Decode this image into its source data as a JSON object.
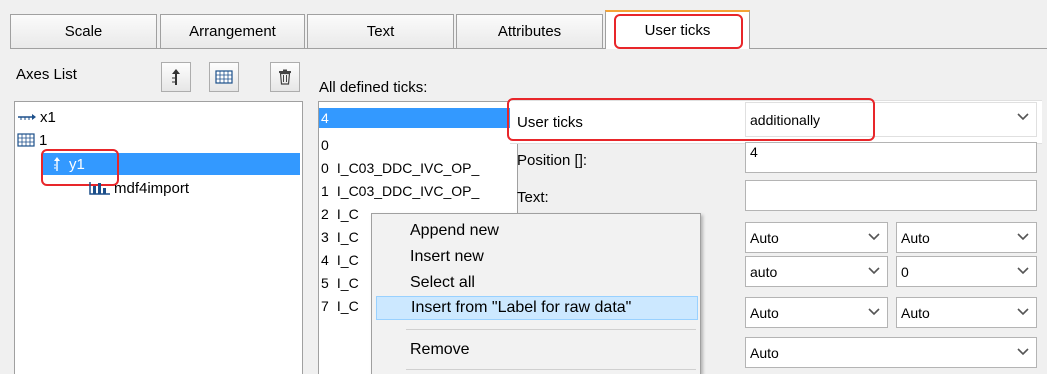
{
  "tabs": [
    {
      "label": "Scale"
    },
    {
      "label": "Arrangement"
    },
    {
      "label": "Text"
    },
    {
      "label": "Attributes"
    },
    {
      "label": "User ticks",
      "active": true
    }
  ],
  "axes_list": {
    "title": "Axes List",
    "toolbar": {
      "new_axis_icon": "axis-arrow-icon",
      "grid_icon": "grid-icon",
      "delete_icon": "trash-icon"
    },
    "tree": [
      {
        "label": "x1",
        "icon": "x-axis-icon"
      },
      {
        "label": "1",
        "icon": "grid-icon"
      },
      {
        "label": "y1",
        "icon": "y-axis-icon",
        "selected": true
      },
      {
        "label": "mdf4import",
        "icon": "chart-icon"
      }
    ]
  },
  "ticks": {
    "title": "All defined ticks:",
    "items": [
      {
        "n": "4",
        "text": ""
      },
      {
        "n": "0",
        "text": ""
      },
      {
        "n": "0",
        "text": "I_C03_DDC_IVC_OP_"
      },
      {
        "n": "1",
        "text": "I_C03_DDC_IVC_OP_"
      },
      {
        "n": "2",
        "text": "I_C"
      },
      {
        "n": "3",
        "text": "I_C"
      },
      {
        "n": "4",
        "text": "I_C"
      },
      {
        "n": "5",
        "text": "I_C"
      },
      {
        "n": "7",
        "text": "I_C"
      }
    ]
  },
  "properties": {
    "user_ticks_label": "User ticks",
    "user_ticks_value": "additionally",
    "position_label": "Position []:",
    "position_value": "4",
    "text_label": "Text:",
    "text_value": "",
    "row1": {
      "a": "Auto",
      "b": "Auto"
    },
    "row2": {
      "a": "auto",
      "b": "0"
    },
    "row3": {
      "a": "Auto",
      "b": "Auto"
    },
    "row4": {
      "a": "Auto"
    }
  },
  "context_menu": {
    "items": [
      {
        "label": "Append new"
      },
      {
        "label": "Insert new"
      },
      {
        "label": "Select all"
      },
      {
        "label": "Insert from \"Label for raw data\"",
        "highlighted": true
      },
      {
        "label": "Remove"
      }
    ]
  },
  "colors": {
    "selection": "#3399ff",
    "highlight_outline": "#e8262a",
    "menu_highlight": "#cce8ff"
  }
}
